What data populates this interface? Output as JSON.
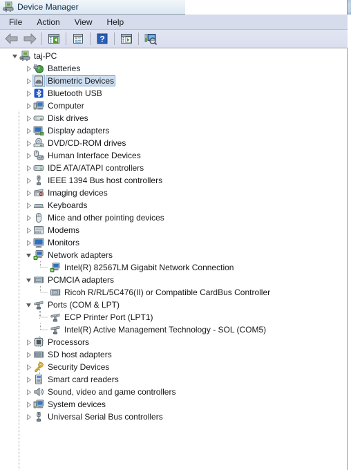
{
  "window": {
    "title": "Device Manager",
    "title_icon": "device-manager-icon"
  },
  "backdrop": {
    "description": "blurred browser tab strip visible behind window"
  },
  "menubar": {
    "items": [
      {
        "label": "File",
        "name": "menu-file"
      },
      {
        "label": "Action",
        "name": "menu-action"
      },
      {
        "label": "View",
        "name": "menu-view"
      },
      {
        "label": "Help",
        "name": "menu-help"
      }
    ]
  },
  "toolbar": {
    "buttons": [
      {
        "name": "back-button",
        "icon": "back-arrow-icon",
        "tooltip": "Back"
      },
      {
        "name": "forward-button",
        "icon": "forward-arrow-icon",
        "tooltip": "Forward"
      },
      {
        "name": "show-hide-console-tree-button",
        "icon": "console-tree-icon",
        "tooltip": "Show/Hide Console Tree"
      },
      {
        "name": "properties-button",
        "icon": "properties-icon",
        "tooltip": "Properties"
      },
      {
        "name": "help-button",
        "icon": "help-question-icon",
        "tooltip": "Help"
      },
      {
        "name": "update-driver-button",
        "icon": "update-driver-icon",
        "tooltip": "Update Driver Software"
      },
      {
        "name": "scan-for-hardware-changes-button",
        "icon": "scan-hardware-icon",
        "tooltip": "Scan for hardware changes"
      }
    ]
  },
  "tree": {
    "root": {
      "label": "taj-PC",
      "icon": "computer-root-icon",
      "expanded": true
    },
    "nodes": [
      {
        "label": "Batteries",
        "icon": "battery-icon",
        "level": 1,
        "expanded": false,
        "selected": false
      },
      {
        "label": "Biometric Devices",
        "icon": "fingerprint-icon",
        "level": 1,
        "expanded": false,
        "selected": true
      },
      {
        "label": "Bluetooth USB",
        "icon": "bluetooth-icon",
        "level": 1,
        "expanded": false,
        "selected": false
      },
      {
        "label": "Computer",
        "icon": "computer-icon",
        "level": 1,
        "expanded": false,
        "selected": false
      },
      {
        "label": "Disk drives",
        "icon": "disk-drive-icon",
        "level": 1,
        "expanded": false,
        "selected": false
      },
      {
        "label": "Display adapters",
        "icon": "display-adapter-icon",
        "level": 1,
        "expanded": false,
        "selected": false
      },
      {
        "label": "DVD/CD-ROM drives",
        "icon": "dvd-drive-icon",
        "level": 1,
        "expanded": false,
        "selected": false
      },
      {
        "label": "Human Interface Devices",
        "icon": "hid-icon",
        "level": 1,
        "expanded": false,
        "selected": false
      },
      {
        "label": "IDE ATA/ATAPI controllers",
        "icon": "ide-controller-icon",
        "level": 1,
        "expanded": false,
        "selected": false
      },
      {
        "label": "IEEE 1394 Bus host controllers",
        "icon": "ieee1394-icon",
        "level": 1,
        "expanded": false,
        "selected": false
      },
      {
        "label": "Imaging devices",
        "icon": "imaging-device-icon",
        "level": 1,
        "expanded": false,
        "selected": false
      },
      {
        "label": "Keyboards",
        "icon": "keyboard-icon",
        "level": 1,
        "expanded": false,
        "selected": false
      },
      {
        "label": "Mice and other pointing devices",
        "icon": "mouse-icon",
        "level": 1,
        "expanded": false,
        "selected": false
      },
      {
        "label": "Modems",
        "icon": "modem-icon",
        "level": 1,
        "expanded": false,
        "selected": false
      },
      {
        "label": "Monitors",
        "icon": "monitor-icon",
        "level": 1,
        "expanded": false,
        "selected": false
      },
      {
        "label": "Network adapters",
        "icon": "network-adapter-icon",
        "level": 1,
        "expanded": true,
        "selected": false
      },
      {
        "label": "Intel(R) 82567LM Gigabit Network Connection",
        "icon": "network-adapter-icon",
        "level": 2,
        "expanded": null,
        "selected": false
      },
      {
        "label": "PCMCIA adapters",
        "icon": "pcmcia-icon",
        "level": 1,
        "expanded": true,
        "selected": false
      },
      {
        "label": "Ricoh R/RL/5C476(II) or Compatible CardBus Controller",
        "icon": "pcmcia-icon",
        "level": 2,
        "expanded": null,
        "selected": false
      },
      {
        "label": "Ports (COM & LPT)",
        "icon": "port-icon",
        "level": 1,
        "expanded": true,
        "selected": false
      },
      {
        "label": "ECP Printer Port (LPT1)",
        "icon": "port-icon",
        "level": 2,
        "expanded": null,
        "selected": false
      },
      {
        "label": "Intel(R) Active Management Technology - SOL (COM5)",
        "icon": "port-icon",
        "level": 2,
        "expanded": null,
        "selected": false
      },
      {
        "label": "Processors",
        "icon": "processor-icon",
        "level": 1,
        "expanded": false,
        "selected": false
      },
      {
        "label": "SD host adapters",
        "icon": "sd-host-icon",
        "level": 1,
        "expanded": false,
        "selected": false
      },
      {
        "label": "Security Devices",
        "icon": "security-key-icon",
        "level": 1,
        "expanded": false,
        "selected": false
      },
      {
        "label": "Smart card readers",
        "icon": "smartcard-reader-icon",
        "level": 1,
        "expanded": false,
        "selected": false
      },
      {
        "label": "Sound, video and game controllers",
        "icon": "speaker-icon",
        "level": 1,
        "expanded": false,
        "selected": false
      },
      {
        "label": "System devices",
        "icon": "system-device-icon",
        "level": 1,
        "expanded": false,
        "selected": false
      },
      {
        "label": "Universal Serial Bus controllers",
        "icon": "usb-icon",
        "level": 1,
        "expanded": false,
        "selected": false
      }
    ]
  },
  "colors": {
    "selection_fill": "#cddef0",
    "selection_border": "#7ba2cc",
    "menubar_bg": "#d7dced",
    "toolbar_bg": "#e2e6f3",
    "text": "#16181b"
  }
}
